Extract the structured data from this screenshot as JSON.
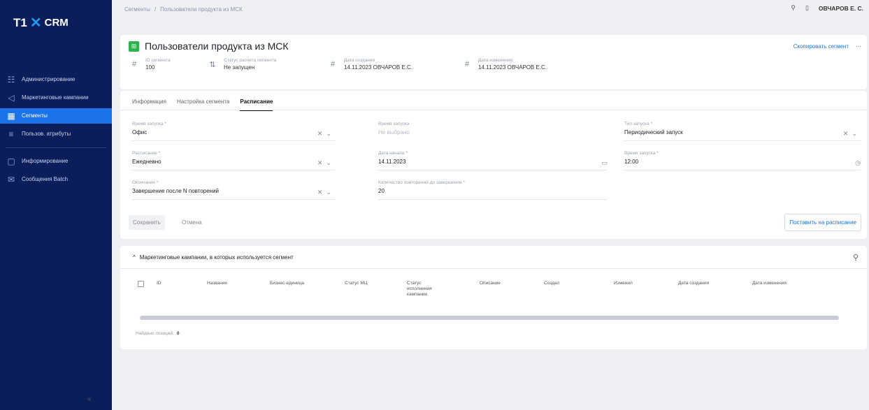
{
  "brand": {
    "t1": "T1",
    "x": "✕",
    "crm": "CRM",
    "accent": "#1a73e8",
    "sidebar_bg": "#0b1e5b"
  },
  "sidebar": {
    "items": [
      {
        "label": "Администрирование",
        "icon": "admin-icon"
      },
      {
        "label": "Маркетинговые кампании",
        "icon": "megaphone-icon"
      },
      {
        "label": "Сегменты",
        "icon": "segments-icon",
        "active": true
      },
      {
        "label": "Пользов. атрибуты",
        "icon": "attributes-icon"
      },
      {
        "label": "Информирование",
        "icon": "chat-icon"
      },
      {
        "label": "Сообщения Batch",
        "icon": "mail-icon"
      }
    ],
    "collapse": "«"
  },
  "breadcrumb": {
    "root": "Сегменты",
    "sep": "/",
    "current": "Пользователи продукта из МСК"
  },
  "topbar": {
    "user": "ОВЧАРОВ Е. С."
  },
  "header": {
    "title": "Пользователи продукта из МСК",
    "actions": {
      "copy": "Скопировать сегмент",
      "more": "···"
    },
    "meta": [
      {
        "label": "ID сегмента",
        "value": "100"
      },
      {
        "label": "Статус расчета сегмента",
        "value": "Не запущен"
      },
      {
        "label": "Дата создания",
        "value": "14.11.2023 ОВЧАРОВ Е.С."
      },
      {
        "label": "Дата изменения",
        "value": "14.11.2023 ОВЧАРОВ Е.С."
      }
    ]
  },
  "tabs": [
    "Информация",
    "Настройка сегмента",
    "Расписание"
  ],
  "active_tab": 2,
  "form": {
    "f1": {
      "label": "Время запуска *",
      "value": "Офис"
    },
    "f2": {
      "label": "Время запуска",
      "value": "Не выбрано"
    },
    "f3": {
      "label": "Тип запуска *",
      "value": "Периодический запуск"
    },
    "f4": {
      "label": "Расписание *",
      "value": "Ежедневно"
    },
    "f5": {
      "label": "Дата начала *",
      "value": "14.11.2023"
    },
    "f6": {
      "label": "Время запуска *",
      "value": "12:00"
    },
    "f7": {
      "label": "Окончание *",
      "value": "Завершение после N повторений"
    },
    "f8": {
      "label": "Количество повторений до завершения *",
      "value": "20"
    }
  },
  "buttons": {
    "save": "Сохранить",
    "cancel": "Отмена",
    "schedule": "Поставить на расписание"
  },
  "campaigns": {
    "title": "Маркетинговые кампании, в которых используется сегмент",
    "collapse_glyph": "^",
    "columns": [
      "ID",
      "Название",
      "Бизнес-единица",
      "Статус МЦ",
      "Статус исполнения кампании",
      "Описание",
      "Создал",
      "Изменил",
      "Дата создания",
      "Дата изменения"
    ],
    "found_label": "Найдено позиций:",
    "found_count": "0"
  }
}
